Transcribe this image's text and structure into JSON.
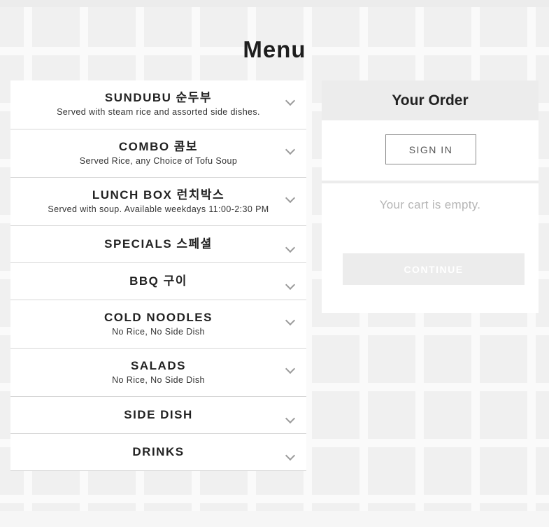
{
  "menu": {
    "title": "Menu",
    "categories": [
      {
        "name": "SUNDUBU 순두부",
        "description": "Served with steam rice and assorted side dishes."
      },
      {
        "name": "COMBO 콤보",
        "description": "Served Rice, any Choice of Tofu Soup"
      },
      {
        "name": "LUNCH BOX 런치박스",
        "description": "Served with soup. Available weekdays 11:00-2:30 PM"
      },
      {
        "name": "SPECIALS 스페셜"
      },
      {
        "name": "BBQ 구이"
      },
      {
        "name": "COLD NOODLES",
        "description": "No Rice, No Side Dish"
      },
      {
        "name": "SALADS",
        "description": "No Rice, No Side Dish"
      },
      {
        "name": "SIDE DISH"
      },
      {
        "name": "DRINKS"
      }
    ]
  },
  "order": {
    "title": "Your Order",
    "sign_in_label": "SIGN IN",
    "empty_text": "Your cart is empty.",
    "continue_label": "CONTINUE"
  },
  "icons": {
    "expand": "chevron-down-icon"
  },
  "colors": {
    "panel_header": "#ececec",
    "empty_text": "#b5b5b5",
    "disabled_button": "#ececec"
  }
}
